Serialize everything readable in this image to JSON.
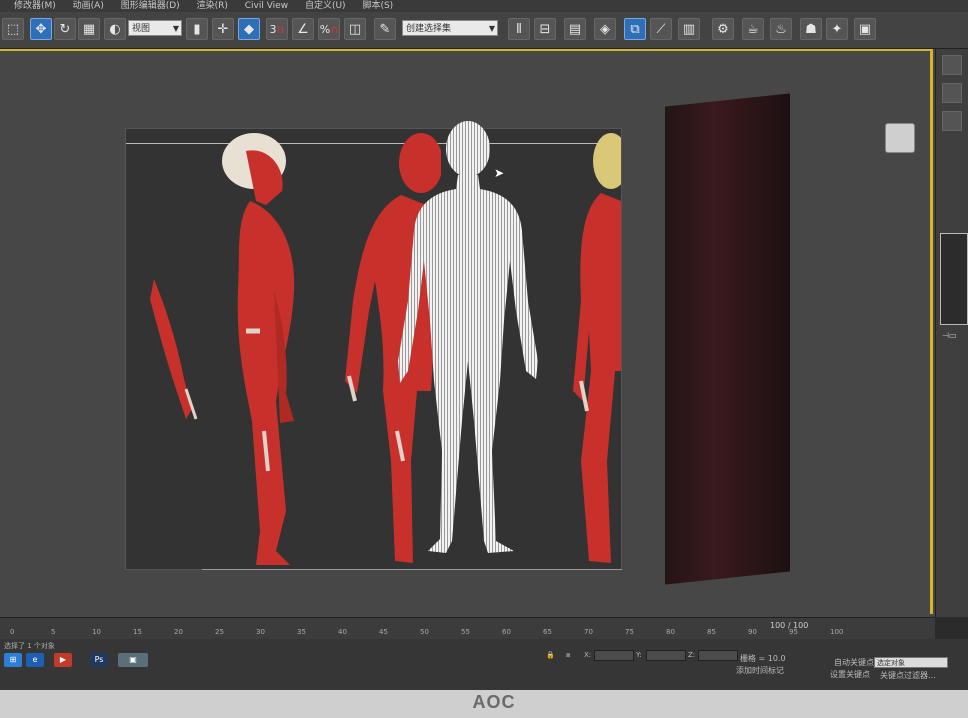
{
  "menu": {
    "items": [
      "修改器(M)",
      "动画(A)",
      "图形编辑器(D)",
      "渲染(R)",
      "Civil View",
      "自定义(U)",
      "脚本(S)"
    ]
  },
  "toolbar": {
    "view_dropdown": "视图",
    "selection_set_dropdown": "创建选择集",
    "snap_label": "3",
    "percent_label": "%"
  },
  "viewport": {
    "label": "",
    "cursor": "➤"
  },
  "timeline": {
    "frame_counter": "100 / 100",
    "ticks": [
      "0",
      "5",
      "10",
      "15",
      "20",
      "25",
      "30",
      "35",
      "40",
      "45",
      "50",
      "55",
      "60",
      "65",
      "70",
      "75",
      "80",
      "85",
      "90",
      "95",
      "100"
    ]
  },
  "status": {
    "left_text": "选择了 1 个对象",
    "x_label": "X:",
    "y_label": "Y:",
    "z_label": "Z:",
    "grid": "栅格 = 10.0",
    "add_time_tag": "添加时间标记",
    "auto_key": "自动关键点",
    "set_key": "设置关键点",
    "selected_dropdown": "选定对象",
    "key_filters": "关键点过滤器..."
  },
  "monitor": {
    "brand": "AOC"
  },
  "colors": {
    "accent": "#2f6fb8",
    "muscle": "#c8312b",
    "highlight": "#d7b52a"
  }
}
